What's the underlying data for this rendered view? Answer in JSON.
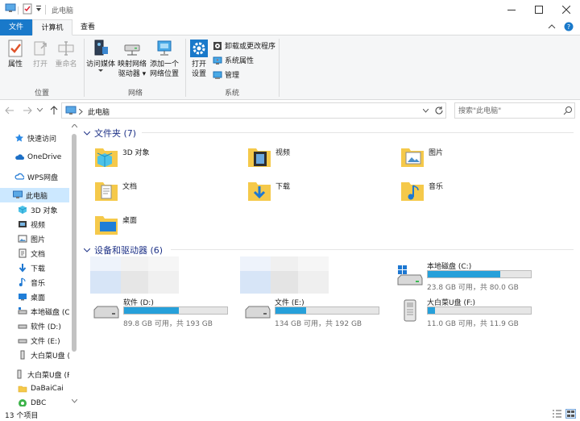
{
  "window": {
    "title": "此电脑"
  },
  "ribbon": {
    "tabs": [
      "文件",
      "计算机",
      "查看"
    ],
    "groups": {
      "location": {
        "label": "位置",
        "buttons": [
          "属性",
          "打开",
          "重命名"
        ]
      },
      "network": {
        "label": "网络",
        "media_l1": "访问媒体",
        "map_l1": "映射网络",
        "map_l2": "驱动器",
        "add_l1": "添加一个",
        "add_l2": "网络位置"
      },
      "system": {
        "label": "系统",
        "settings_l1": "打开",
        "settings_l2": "设置",
        "small": [
          "卸载或更改程序",
          "系统属性",
          "管理"
        ]
      }
    }
  },
  "address": {
    "path": "此电脑",
    "search_placeholder": "搜索\"此电脑\""
  },
  "nav": {
    "items": [
      {
        "label": "快速访问",
        "icon": "star-icon"
      },
      {
        "label": "OneDrive",
        "icon": "cloud-icon"
      },
      {
        "label": "WPS网盘",
        "icon": "wps-cloud-icon"
      },
      {
        "label": "此电脑",
        "icon": "computer-icon",
        "selected": true
      },
      {
        "label": "3D 对象",
        "icon": "cube-icon"
      },
      {
        "label": "视频",
        "icon": "video-icon"
      },
      {
        "label": "图片",
        "icon": "picture-icon"
      },
      {
        "label": "文档",
        "icon": "document-icon"
      },
      {
        "label": "下载",
        "icon": "download-icon"
      },
      {
        "label": "音乐",
        "icon": "music-icon"
      },
      {
        "label": "桌面",
        "icon": "desktop-icon"
      },
      {
        "label": "本地磁盘 (C",
        "icon": "drive-icon"
      },
      {
        "label": "软件 (D:)",
        "icon": "drive-icon"
      },
      {
        "label": "文件 (E:)",
        "icon": "drive-icon"
      },
      {
        "label": "大白菜U盘 (F",
        "icon": "usb-icon"
      },
      {
        "label": "大白菜U盘 (F",
        "icon": "usb-icon"
      },
      {
        "label": "DaBaiCai",
        "icon": "folder-icon"
      },
      {
        "label": "DBC",
        "icon": "dbc-icon"
      }
    ]
  },
  "content": {
    "folders_header": "文件夹 (7)",
    "folders": [
      "3D 对象",
      "视频",
      "图片",
      "文档",
      "下载",
      "音乐",
      "桌面"
    ],
    "devices_header": "设备和驱动器 (6)",
    "drives": [
      {
        "name": "本地磁盘 (C:)",
        "size": "23.8 GB 可用，共 80.0 GB",
        "used_fraction": 0.7
      },
      {
        "name": "软件 (D:)",
        "size": "89.8 GB 可用，共 193 GB",
        "used_fraction": 0.53
      },
      {
        "name": "文件 (E:)",
        "size": "134 GB 可用，共 192 GB",
        "used_fraction": 0.3
      },
      {
        "name": "大白菜U盘 (F:)",
        "size": "11.0 GB 可用，共 11.9 GB",
        "used_fraction": 0.07
      }
    ]
  },
  "status": {
    "count": "13 个项目"
  },
  "colors": {
    "accent": "#1979ca",
    "selection": "#cce8ff",
    "bar_fill": "#26a0da",
    "section_header": "#1e3287"
  }
}
